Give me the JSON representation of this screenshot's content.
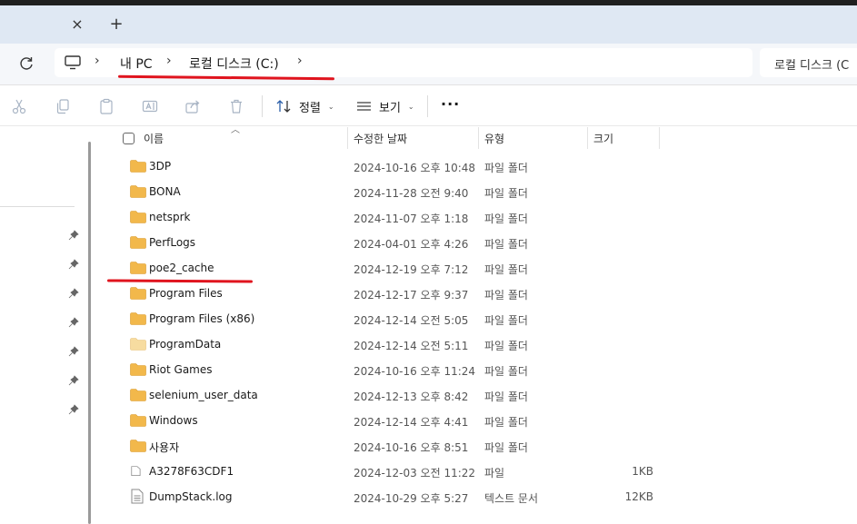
{
  "tabs": {
    "close_icon": "×",
    "new_tab_icon": "+"
  },
  "breadcrumb": {
    "items": [
      "내 PC",
      "로컬 디스크 (C:)"
    ],
    "separator": "›"
  },
  "search": {
    "text": "로컬 디스크 (C"
  },
  "toolbar": {
    "sort_label": "정렬",
    "view_label": "보기",
    "more_label": "···"
  },
  "columns": {
    "name": "이름",
    "date": "수정한 날짜",
    "type": "유형",
    "size": "크기"
  },
  "files": [
    {
      "name": "3DP",
      "date": "2024-10-16 오후 10:48",
      "type": "파일 폴더",
      "size": "",
      "icon": "folder-icon"
    },
    {
      "name": "BONA",
      "date": "2024-11-28 오전 9:40",
      "type": "파일 폴더",
      "size": "",
      "icon": "folder-icon"
    },
    {
      "name": "netsprk",
      "date": "2024-11-07 오후 1:18",
      "type": "파일 폴더",
      "size": "",
      "icon": "folder-icon"
    },
    {
      "name": "PerfLogs",
      "date": "2024-04-01 오후 4:26",
      "type": "파일 폴더",
      "size": "",
      "icon": "folder-icon"
    },
    {
      "name": "poe2_cache",
      "date": "2024-12-19 오후 7:12",
      "type": "파일 폴더",
      "size": "",
      "icon": "folder-icon"
    },
    {
      "name": "Program Files",
      "date": "2024-12-17 오후 9:37",
      "type": "파일 폴더",
      "size": "",
      "icon": "folder-icon"
    },
    {
      "name": "Program Files (x86)",
      "date": "2024-12-14 오전 5:05",
      "type": "파일 폴더",
      "size": "",
      "icon": "folder-icon"
    },
    {
      "name": "ProgramData",
      "date": "2024-12-14 오전 5:11",
      "type": "파일 폴더",
      "size": "",
      "icon": "hidden-folder-icon"
    },
    {
      "name": "Riot Games",
      "date": "2024-10-16 오후 11:24",
      "type": "파일 폴더",
      "size": "",
      "icon": "folder-icon"
    },
    {
      "name": "selenium_user_data",
      "date": "2024-12-13 오후 8:42",
      "type": "파일 폴더",
      "size": "",
      "icon": "folder-icon"
    },
    {
      "name": "Windows",
      "date": "2024-12-14 오후 4:41",
      "type": "파일 폴더",
      "size": "",
      "icon": "folder-icon"
    },
    {
      "name": "사용자",
      "date": "2024-10-16 오후 8:51",
      "type": "파일 폴더",
      "size": "",
      "icon": "folder-icon"
    },
    {
      "name": "A3278F63CDF1",
      "date": "2024-12-03 오전 11:22",
      "type": "파일",
      "size": "1KB",
      "icon": "file-icon"
    },
    {
      "name": "DumpStack.log",
      "date": "2024-10-29 오후 5:27",
      "type": "텍스트 문서",
      "size": "12KB",
      "icon": "text-file-icon"
    }
  ],
  "colors": {
    "folder": "#f2b84b",
    "folder_hidden": "#f7dca0",
    "annotation": "#e0141e"
  }
}
